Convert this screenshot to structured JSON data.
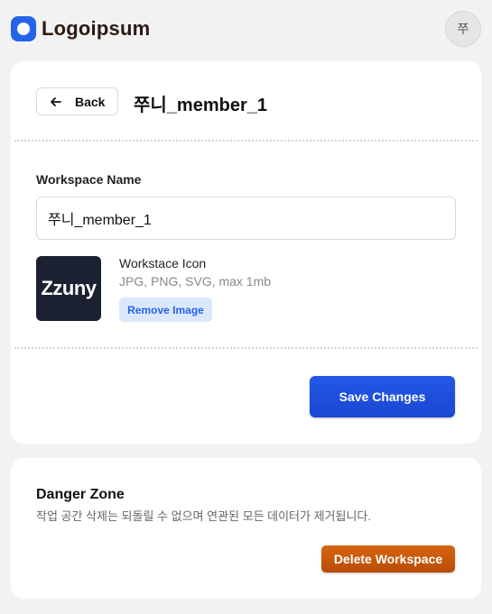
{
  "header": {
    "logo_text": "Logoipsum",
    "avatar_initial": "쭈"
  },
  "workspace": {
    "back_label": "Back",
    "title": "쭈니_member_1",
    "name_label": "Workspace Name",
    "name_value": "쭈니_member_1",
    "icon_text": "Zzuny",
    "icon_title": "Workstace Icon",
    "icon_hint": "JPG, PNG, SVG, max 1mb",
    "remove_label": "Remove Image",
    "save_label": "Save Changes"
  },
  "danger": {
    "title": "Danger Zone",
    "description": "작업 공간 삭제는 되돌릴 수 없으며 연관된 모든 데이터가 제거됩니다.",
    "delete_label": "Delete Workspace"
  },
  "colors": {
    "brand": "#2563eb",
    "save_button": "#1d4ed8",
    "delete_button": "#c75a0c",
    "remove_button_bg": "#dbe8fb"
  }
}
